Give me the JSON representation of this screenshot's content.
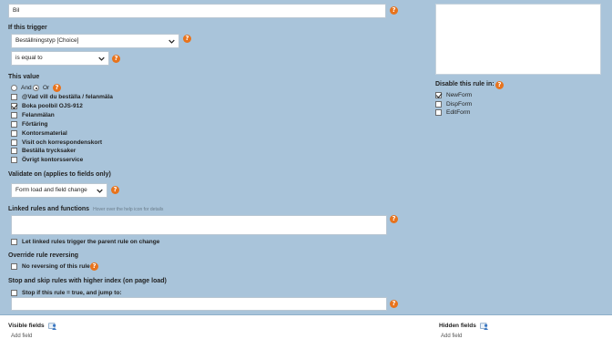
{
  "rule": {
    "title_value": "Bil"
  },
  "trigger": {
    "heading": "If this trigger",
    "field_select": "Beställningstyp [Choice]",
    "operator_select": "is equal to"
  },
  "value": {
    "heading": "This value",
    "and_label": "And",
    "or_label": "Or",
    "options": [
      {
        "label": "@Vad vill du beställa / felanmäla",
        "checked": false
      },
      {
        "label": "Boka poolbil OJS-912",
        "checked": true
      },
      {
        "label": "Felanmälan",
        "checked": false
      },
      {
        "label": "Förtäring",
        "checked": false
      },
      {
        "label": "Kontorsmaterial",
        "checked": false
      },
      {
        "label": "Visit och korrespondenskort",
        "checked": false
      },
      {
        "label": "Beställa trycksaker",
        "checked": false
      },
      {
        "label": "Övrigt kontorsservice",
        "checked": false
      }
    ]
  },
  "validate": {
    "heading": "Validate on (applies to fields only)",
    "select_value": "Form load and field change"
  },
  "linked": {
    "heading": "Linked rules and functions",
    "hint": "Hover over the help icon for details",
    "checkbox_label": "Let linked rules trigger the parent rule on change"
  },
  "override": {
    "heading": "Override rule reversing",
    "checkbox_label": "No reversing of this rule"
  },
  "stop": {
    "heading": "Stop and skip rules with higher index (on page load)",
    "checkbox_label": "Stop if this rule = true, and jump to:"
  },
  "disable": {
    "heading": "Disable this rule in:",
    "options": [
      {
        "label": "NewForm",
        "checked": true
      },
      {
        "label": "DispForm",
        "checked": false
      },
      {
        "label": "EditForm",
        "checked": false
      }
    ]
  },
  "footer": {
    "visible_label": "Visible fields",
    "visible_sub": "Add field",
    "hidden_label": "Hidden fields",
    "hidden_sub": "Add field"
  },
  "colors": {
    "panel_bg": "#a9c4da",
    "help_icon": "#e8731c"
  }
}
